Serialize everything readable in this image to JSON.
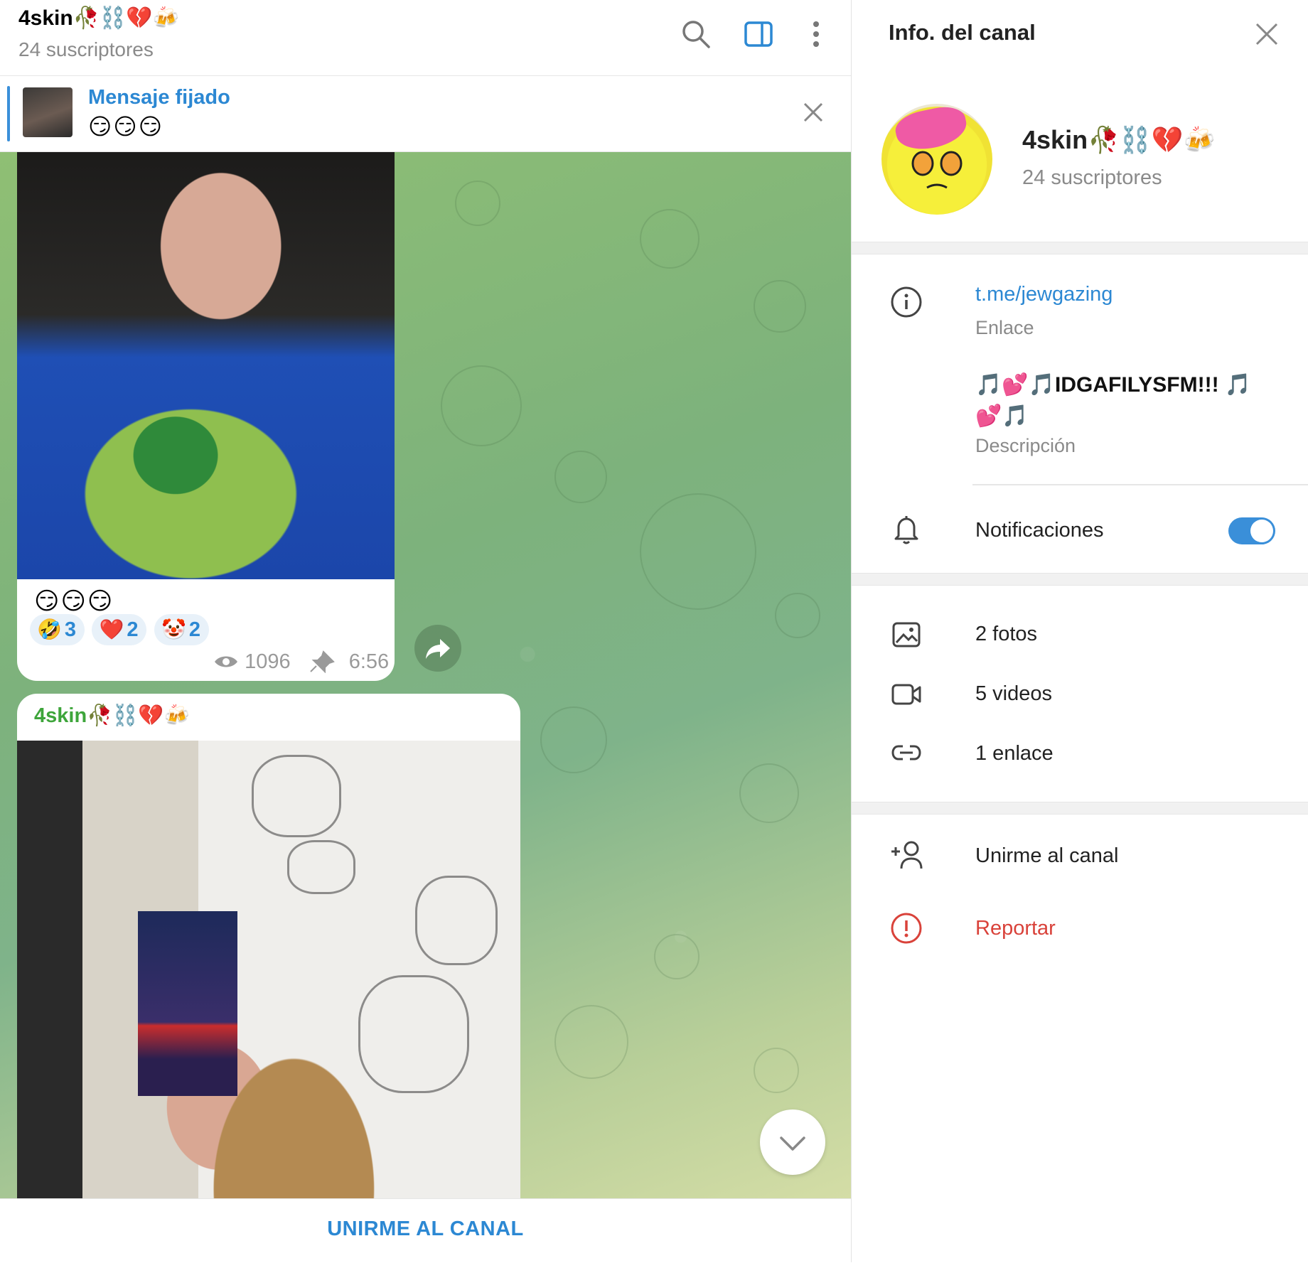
{
  "chat": {
    "title": "4skin🥀⛓️💔🍻",
    "subtitle": "24 suscriptores",
    "header_icons": [
      "search-icon",
      "sidebar-toggle-icon",
      "more-vertical-icon"
    ],
    "pinned": {
      "title": "Mensaje fijado",
      "text": "😏😏😏"
    },
    "messages": [
      {
        "text": "😏😏😏",
        "reactions": [
          {
            "emoji": "🤣",
            "count": "3"
          },
          {
            "emoji": "❤️",
            "count": "2"
          },
          {
            "emoji": "🤡",
            "count": "2"
          }
        ],
        "views": "1096",
        "time": "6:56"
      },
      {
        "author": "4skin🥀⛓️💔🍻"
      }
    ],
    "join_button": "UNIRME AL CANAL"
  },
  "panel": {
    "title": "Info. del canal",
    "name": "4skin🥀⛓️💔🍻",
    "subscribers": "24 suscriptores",
    "link": "t.me/jewgazing",
    "link_label": "Enlace",
    "description": "🎵💕🎵IDGAFILYSFM!!! 🎵💕🎵",
    "description_label": "Descripción",
    "notifications_label": "Notificaciones",
    "notifications_on": true,
    "media": [
      {
        "icon": "photo-icon",
        "label": "2 fotos"
      },
      {
        "icon": "video-icon",
        "label": "5 videos"
      },
      {
        "icon": "link-icon",
        "label": "1 enlace"
      }
    ],
    "join_label": "Unirme al canal",
    "report_label": "Reportar",
    "accent": "#2c88d3",
    "danger": "#d9423a"
  }
}
